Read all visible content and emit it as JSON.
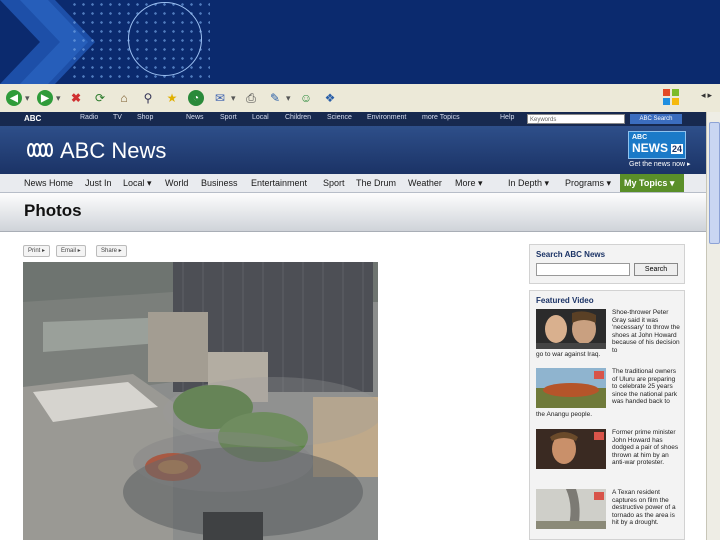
{
  "browser": {
    "toolbar_icons": [
      "back-icon",
      "forward-icon",
      "stop-icon",
      "refresh-icon",
      "home-icon",
      "search-icon",
      "favorites-icon",
      "history-icon",
      "mail-icon",
      "print-icon",
      "edit-icon",
      "messenger-icon",
      "research-icon"
    ]
  },
  "utility_bar": {
    "logo": "ABC",
    "links": [
      "Radio",
      "TV",
      "Shop",
      "News",
      "Sport",
      "Local",
      "Children",
      "Science",
      "Environment",
      "more Topics",
      "Help"
    ],
    "keywords_placeholder": "Keywords",
    "search_button": "ABC Search"
  },
  "header": {
    "title": "ABC News",
    "news24": {
      "line1": "ABC",
      "line2": "NEWS",
      "badge": "24"
    },
    "tagline": "Get the news now ▸"
  },
  "nav": {
    "items": [
      "News Home",
      "Just In",
      "Local ▾",
      "World",
      "Business",
      "Entertainment",
      "Sport",
      "The Drum",
      "Weather",
      "More ▾",
      "In Depth ▾",
      "Programs ▾"
    ],
    "my_topics": "My Topics ▾"
  },
  "page_title": "Photos",
  "share_buttons": [
    "Print ▸",
    "Email ▸",
    "Share ▸"
  ],
  "sidebar": {
    "search": {
      "heading": "Search ABC News",
      "button": "Search"
    },
    "featured": {
      "heading": "Featured Video",
      "items": [
        {
          "text": "Shoe-thrower Peter Gray said it was 'necessary' to throw the shoes at John Howard because of his decision to",
          "tail": "go to war against Iraq."
        },
        {
          "text": "The traditional owners of Uluru are preparing to celebrate 25 years since the national park was handed back to",
          "tail": "the Anangu people."
        },
        {
          "text": "Former prime minister John Howard has dodged a pair of shoes thrown at him by an anti-war protester.",
          "tail": ""
        },
        {
          "text": "A Texan resident captures on film the destructive power of a tornado as the area is hit by a drought.",
          "tail": ""
        }
      ]
    }
  },
  "colors": {
    "banner": "#0b2a6e",
    "header": "#1b3366",
    "my_topics": "#5a8f29"
  }
}
